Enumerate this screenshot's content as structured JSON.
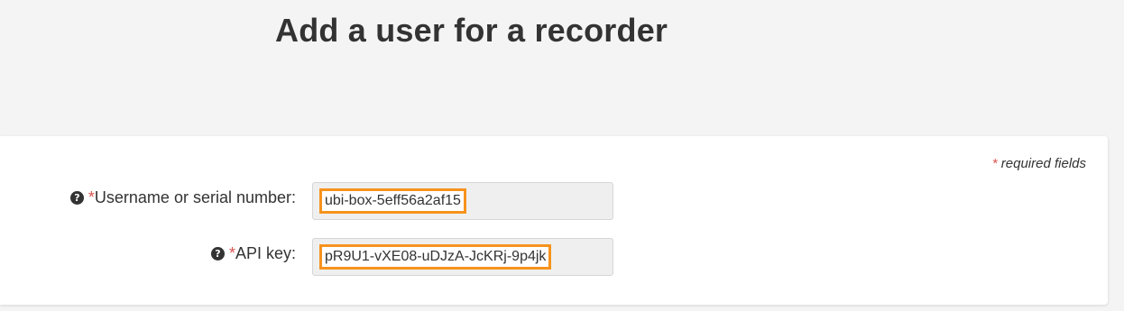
{
  "page": {
    "title": "Add a user for a recorder"
  },
  "form": {
    "required_note_asterisk": "*",
    "required_note_text": " required fields",
    "fields": [
      {
        "label": "Username or serial number:",
        "required_marker": "*",
        "help_icon": "question-circle-icon",
        "value": "ubi-box-5eff56a2af15"
      },
      {
        "label": "API key:",
        "required_marker": "*",
        "help_icon": "question-circle-icon",
        "value": "pR9U1-vXE08-uDJzA-JcKRj-9p4jk"
      }
    ]
  },
  "colors": {
    "highlight": "#f7931e",
    "required": "#d9534f",
    "background": "#f4f4f4",
    "card": "#ffffff"
  }
}
